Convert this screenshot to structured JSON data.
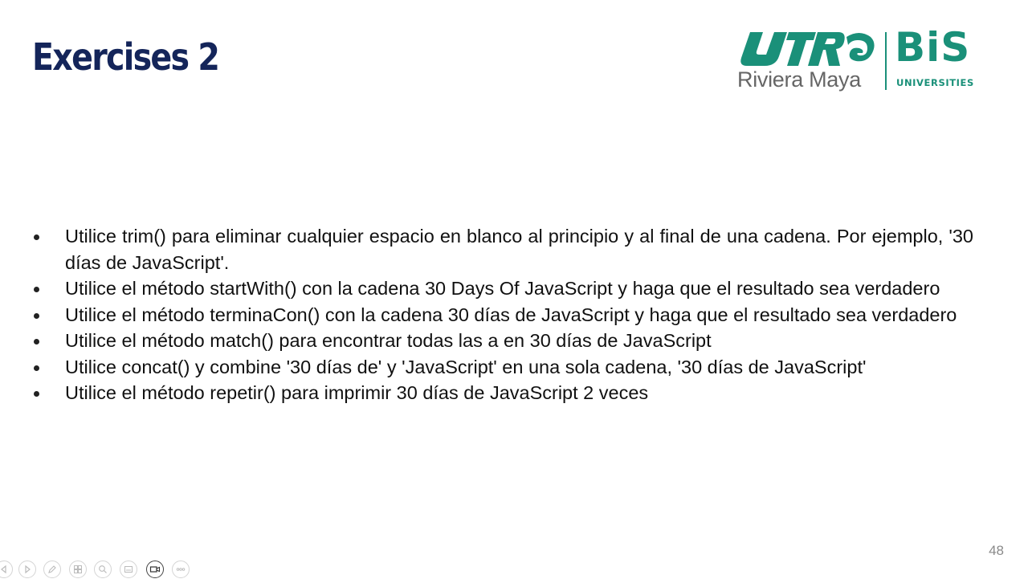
{
  "slide": {
    "title": "Exercises 2",
    "page_number": "48"
  },
  "logo": {
    "mark_text": "UTRM",
    "caption": "Riviera Maya",
    "bis": "BiS",
    "universities": "UNIVERSITIES",
    "brand_color": "#1a9079"
  },
  "bullets": [
    "Utilice trim() para eliminar cualquier espacio en blanco al principio y al final de una cadena. Por ejemplo, '30 días de JavaScript'.",
    "Utilice el método startWith() con la cadena 30 Days Of JavaScript y haga que el resultado sea verdadero",
    "Utilice el método terminaCon() con la cadena 30 días de JavaScript y haga que el resultado sea verdadero",
    "Utilice el método match() para encontrar todas las a en 30 días de JavaScript",
    "Utilice concat() y combine '30 días de' y 'JavaScript' en una sola cadena, '30 días de JavaScript'",
    "Utilice el método repetir() para imprimir 30 días de JavaScript 2 veces"
  ],
  "toolbar": {
    "buttons": [
      "previous-slide-icon",
      "next-slide-icon",
      "pen-icon",
      "slides-overview-icon",
      "zoom-icon",
      "subtitles-icon",
      "camera-icon",
      "more-options-icon"
    ],
    "active_button": "camera-icon"
  },
  "colors": {
    "title": "#14255a",
    "body_text": "#111111",
    "page_number": "#8a8a8a"
  }
}
